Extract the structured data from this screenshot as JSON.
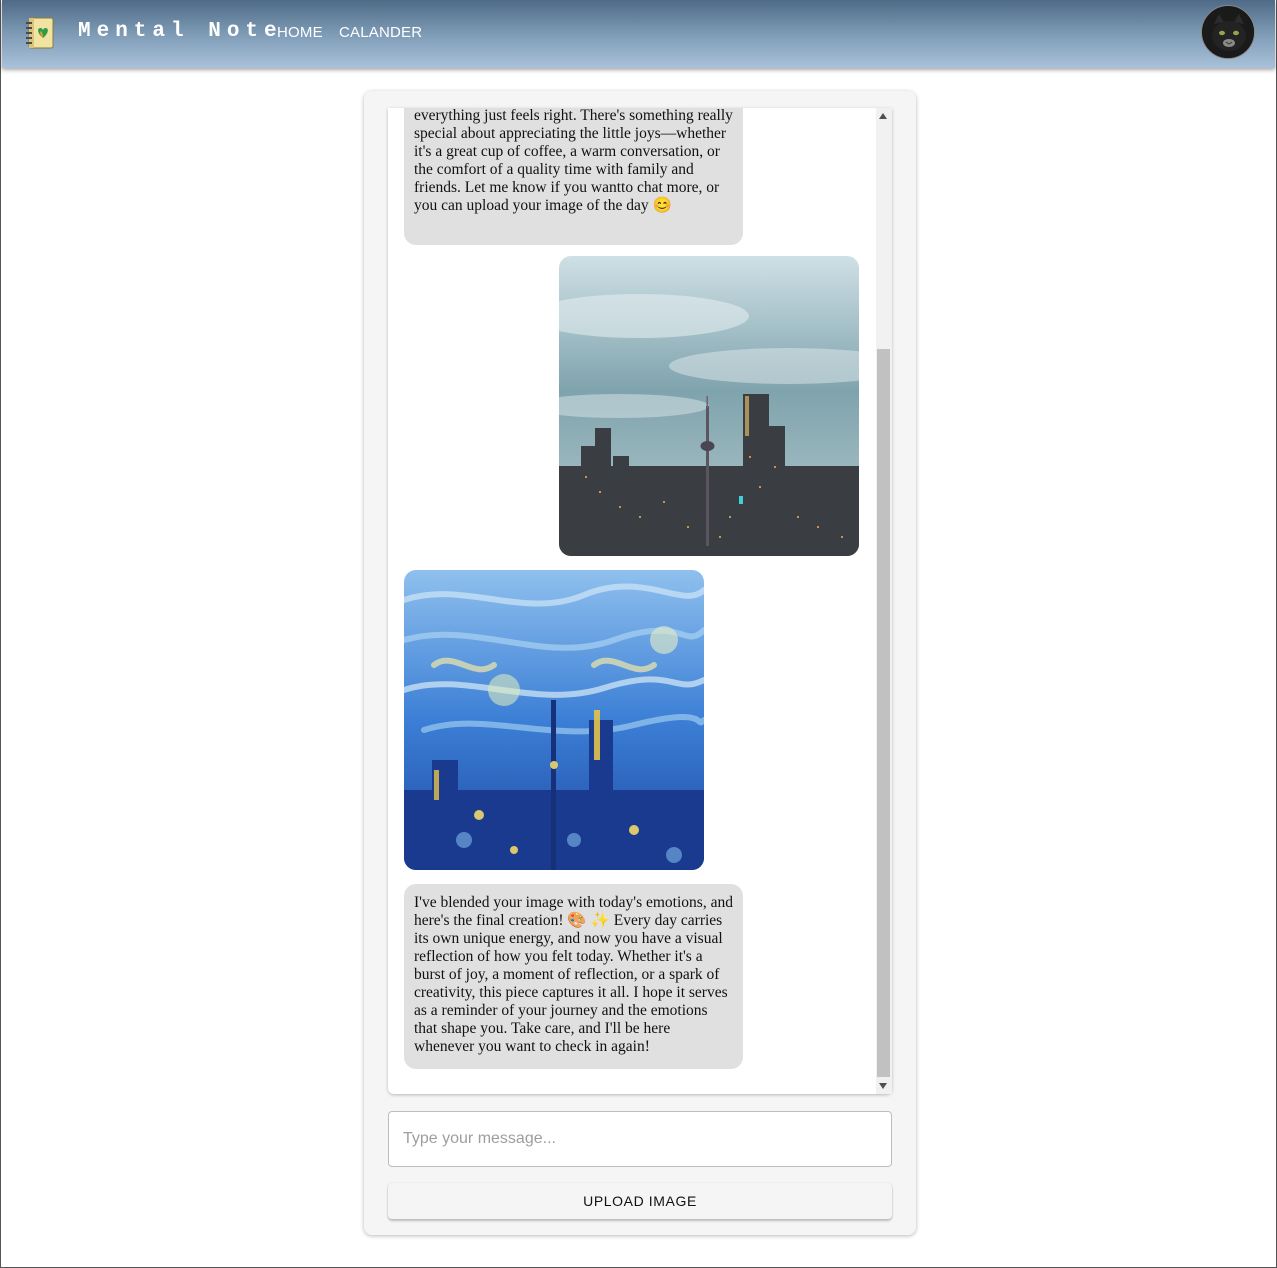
{
  "header": {
    "brand": "Mental Note",
    "nav": [
      {
        "label": "HOME"
      },
      {
        "label": "CALANDER"
      }
    ]
  },
  "chat": {
    "messages": [
      {
        "sender": "bot",
        "type": "text",
        "text": "everything just feels right. There's something really special about appreciating the little joys—whether it's a great cup of coffee, a warm conversation, or the comfort of a quality time with family and friends. Let me know if you wantto chat more, or you can upload your image of the day 😊"
      },
      {
        "sender": "user",
        "type": "image",
        "subject": "city-skyline-photo"
      },
      {
        "sender": "bot",
        "type": "image",
        "subject": "starry-night-style-skyline"
      },
      {
        "sender": "bot",
        "type": "text",
        "text": "I've blended your image with today's emotions, and here's the final creation! 🎨 ✨ Every day carries its own unique energy, and now you have a visual reflection of how you felt today. Whether it's a burst of joy, a moment of reflection, or a spark of creativity, this piece captures it all. I hope it serves as a reminder of your journey and the emotions that shape you. Take care, and I'll be here whenever you want to check in again!"
      }
    ]
  },
  "composer": {
    "placeholder": "Type your message...",
    "upload_label": "UPLOAD IMAGE"
  },
  "colors": {
    "appbar_top": "#4e6a86",
    "appbar_bottom": "#a9c1d9",
    "bubble_bg": "#e0e0e0",
    "panel_bg": "#f5f5f5"
  }
}
